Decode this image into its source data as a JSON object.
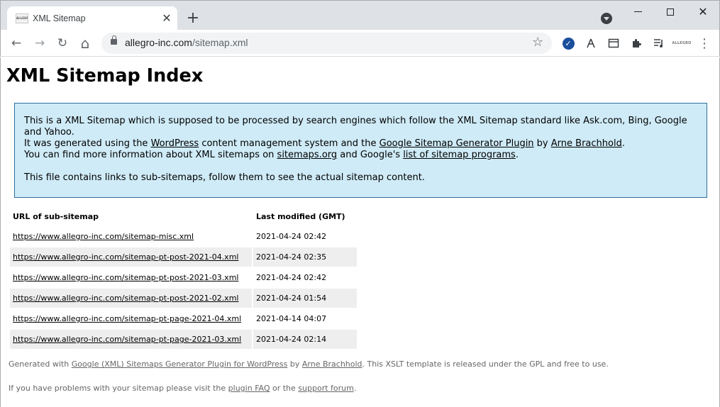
{
  "browser": {
    "tab": {
      "favicon_text": "ALLEGRO",
      "title": "XML Sitemap",
      "close_glyph": "✕"
    },
    "new_tab_glyph": "+",
    "window": {
      "close_glyph": "✕"
    },
    "address": {
      "domain": "allegro-inc.com",
      "path": "/sitemap.xml"
    },
    "toolbar_glyphs": {
      "back": "←",
      "forward": "→",
      "reload": "↻",
      "home": "⌂",
      "star": "☆",
      "check": "✓",
      "menu": "⋮"
    },
    "extensions": [
      "check-extension",
      "compass-extension",
      "calendar-extension",
      "puzzle-extension",
      "media-extension",
      "allegro-extension"
    ],
    "ext_brand_text": "ALLEGRO"
  },
  "page": {
    "title": "XML Sitemap Index",
    "intro": {
      "line1": "This is a XML Sitemap which is supposed to be processed by search engines which follow the XML Sitemap standard like Ask.com, Bing, Google and Yahoo.",
      "line2_a": "It was generated using the ",
      "line2_link1": "WordPress",
      "line2_b": " content management system and the ",
      "line2_link2": "Google Sitemap Generator Plugin",
      "line2_c": " by ",
      "line2_link3": "Arne Brachhold",
      "line2_d": ".",
      "line3_a": "You can find more information about XML sitemaps on ",
      "line3_link1": "sitemaps.org",
      "line3_b": " and Google's ",
      "line3_link2": "list of sitemap programs",
      "line3_c": ".",
      "line4": "This file contains links to sub-sitemaps, follow them to see the actual sitemap content."
    },
    "table": {
      "headers": [
        "URL of sub-sitemap",
        "Last modified (GMT)"
      ],
      "rows": [
        {
          "url": "https://www.allegro-inc.com/sitemap-misc.xml",
          "modified": "2021-04-24 02:42"
        },
        {
          "url": "https://www.allegro-inc.com/sitemap-pt-post-2021-04.xml",
          "modified": "2021-04-24 02:35"
        },
        {
          "url": "https://www.allegro-inc.com/sitemap-pt-post-2021-03.xml",
          "modified": "2021-04-24 02:42"
        },
        {
          "url": "https://www.allegro-inc.com/sitemap-pt-post-2021-02.xml",
          "modified": "2021-04-24 01:54"
        },
        {
          "url": "https://www.allegro-inc.com/sitemap-pt-page-2021-04.xml",
          "modified": "2021-04-14 04:07"
        },
        {
          "url": "https://www.allegro-inc.com/sitemap-pt-page-2021-03.xml",
          "modified": "2021-04-24 02:14"
        }
      ]
    },
    "footer": {
      "line1_a": "Generated with ",
      "line1_link1": "Google (XML) Sitemaps Generator Plugin for WordPress",
      "line1_b": " by ",
      "line1_link2": "Arne Brachhold",
      "line1_c": ". This XSLT template is released under the GPL and free to use.",
      "line2_a": "If you have problems with your sitemap please visit the ",
      "line2_link1": "plugin FAQ",
      "line2_b": " or the ",
      "line2_link2": "support forum",
      "line2_c": "."
    }
  },
  "colors": {
    "intro_bg": "#cfebf7",
    "intro_border": "#2e6e9e",
    "row_highlight": "#eeeeee",
    "tabstrip": "#dee1e6",
    "footer_text": "#666666"
  }
}
